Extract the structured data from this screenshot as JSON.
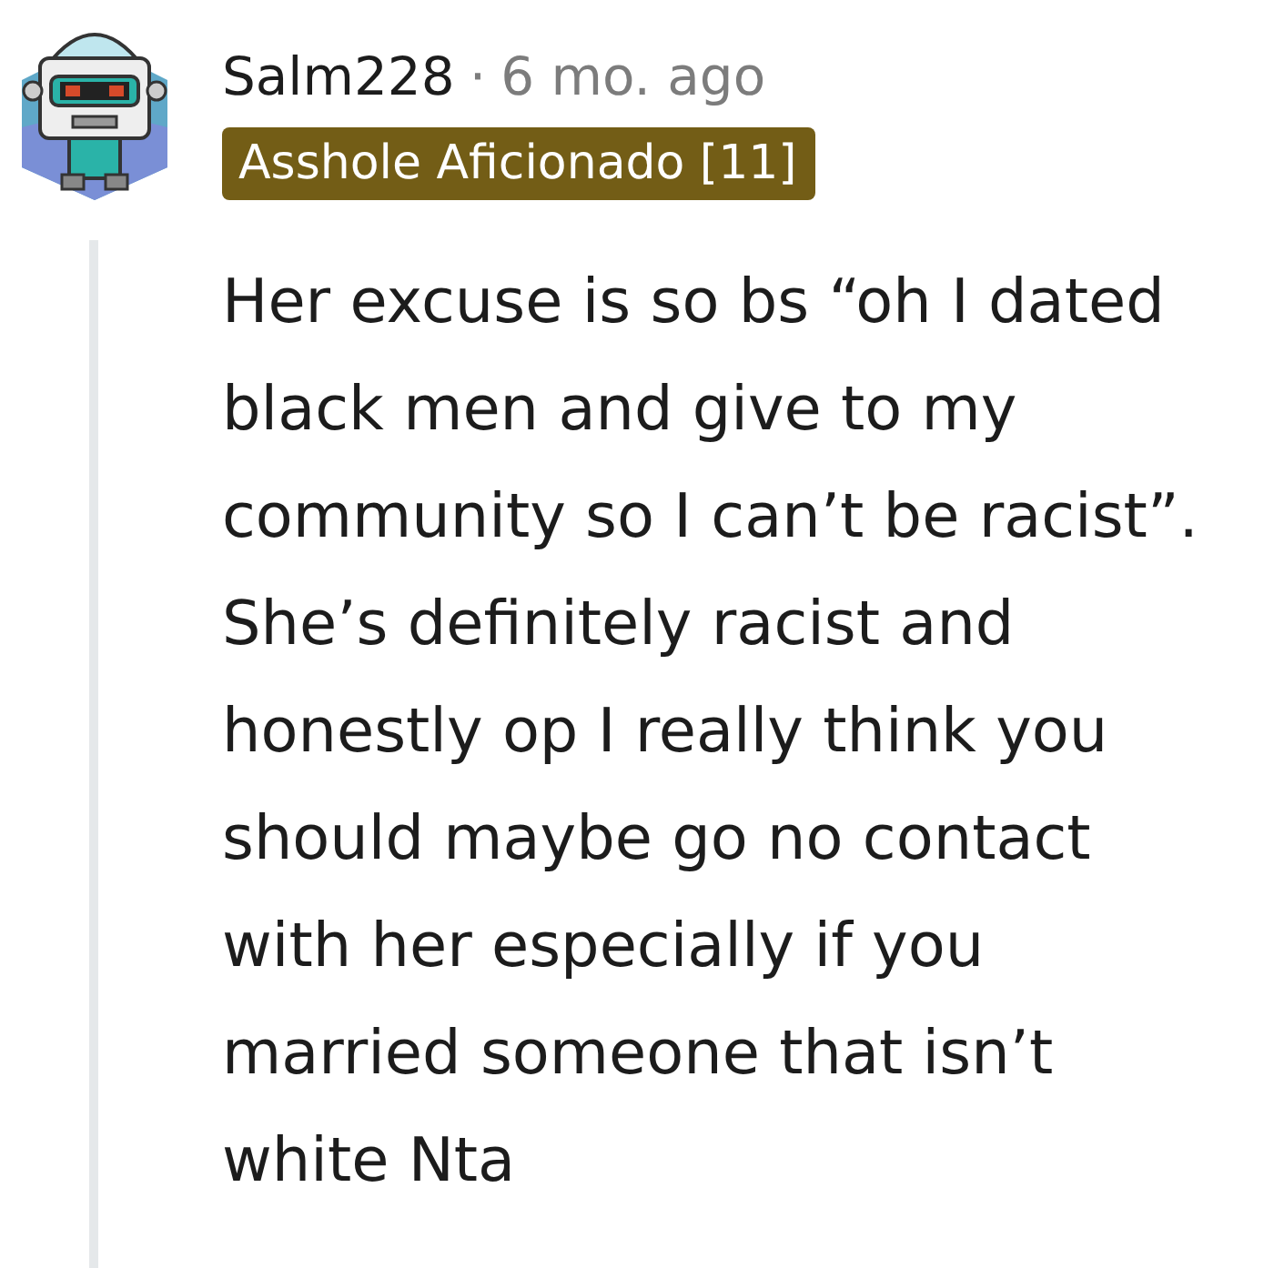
{
  "comment": {
    "author": "Salm228",
    "separator": "·",
    "time": "6 mo. ago",
    "flair": {
      "text": "Asshole Aficionado [11]",
      "color": "#735d16"
    },
    "body": "Her excuse is so bs “oh I dated black men and give to my community so I can’t be racist”. She’s definitely racist and honestly op I really think you should maybe go no contact with her especially if you married someone that isn’t white Nta"
  }
}
